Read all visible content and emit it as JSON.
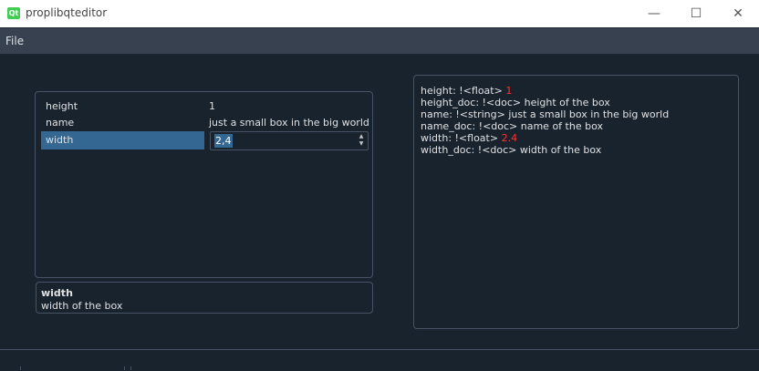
{
  "window": {
    "title": "proplibqteditor",
    "app_icon": "Qt"
  },
  "menubar": {
    "items": [
      "File"
    ]
  },
  "properties": [
    {
      "key": "height",
      "value": "1"
    },
    {
      "key": "name",
      "value": "just a small box in the big world"
    },
    {
      "key": "width",
      "value": "2,4"
    }
  ],
  "doc": {
    "title": "width",
    "text": "width of the box"
  },
  "yaml": {
    "lines": [
      {
        "prefix": "height: !<float> ",
        "value": "1"
      },
      {
        "prefix": "height_doc: !<doc> height of the box",
        "value": ""
      },
      {
        "prefix": "name: !<string> just a small box in the big world",
        "value": ""
      },
      {
        "prefix": "name_doc: !<doc> name of the box",
        "value": ""
      },
      {
        "prefix": "width: !<float> ",
        "value": "2.4"
      },
      {
        "prefix": "width_doc: !<doc> width of the box",
        "value": ""
      }
    ]
  },
  "colors": {
    "background": "#19232d",
    "selection": "#346792",
    "number": "#ff3131"
  }
}
